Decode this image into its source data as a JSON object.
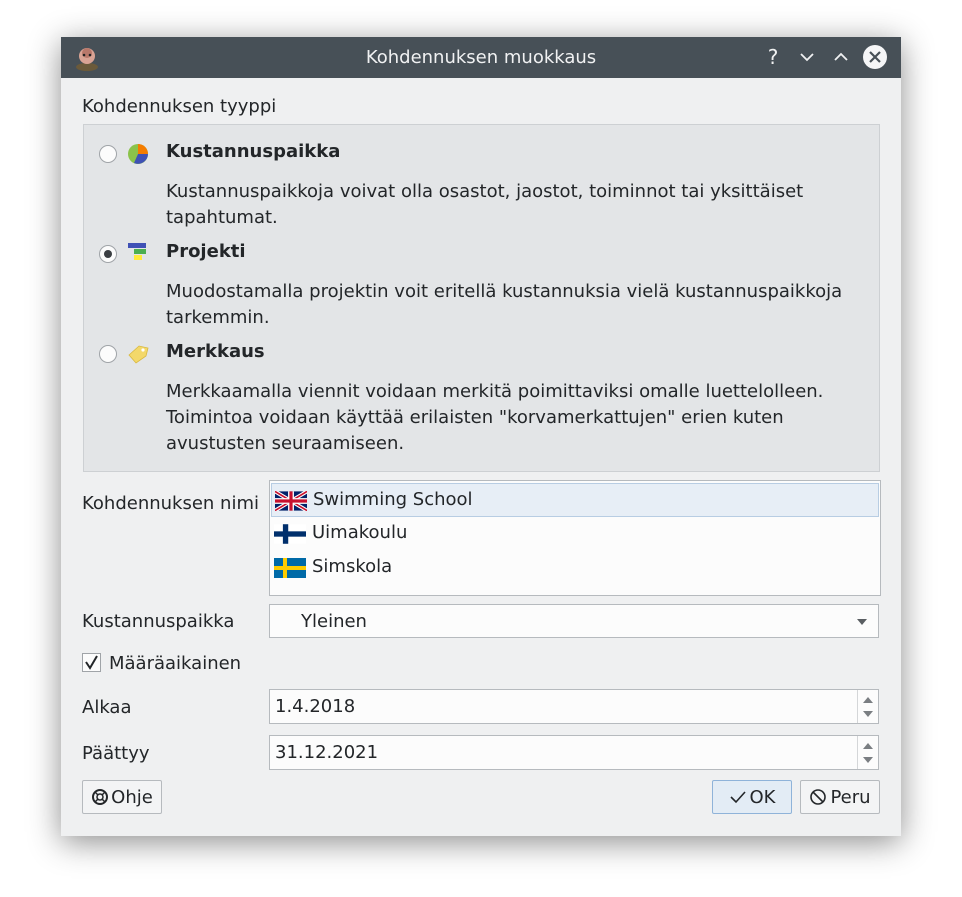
{
  "window": {
    "title": "Kohdennuksen muokkaus"
  },
  "titlebar": {
    "help": "?"
  },
  "allocation_type": {
    "label": "Kohdennuksen tyyppi",
    "options": [
      {
        "title": "Kustannuspaikka",
        "desc_line1": "Kustannuspaikkoja voivat olla osastot, jaostot, toiminnot tai yksittäiset",
        "desc_line2": "tapahtumat.",
        "checked": false
      },
      {
        "title": "Projekti",
        "desc_line1": "Muodostamalla projektin voit eritellä kustannuksia vielä kustannuspaikkoja",
        "desc_line2": "tarkemmin.",
        "checked": true
      },
      {
        "title": "Merkkaus",
        "desc_line1": "Merkkaamalla viennit voidaan merkitä poimittaviksi omalle luettelolleen.",
        "desc_line2": "Toimintoa voidaan käyttää erilaisten \"korvamerkattujen\" erien kuten",
        "desc_line3": "avustusten seuraamiseen.",
        "checked": false
      }
    ]
  },
  "name_field": {
    "label": "Kohdennuksen nimi",
    "entries": [
      {
        "lang": "en",
        "value": "Swimming School",
        "selected": true
      },
      {
        "lang": "fi",
        "value": "Uimakoulu",
        "selected": false
      },
      {
        "lang": "sv",
        "value": "Simskola",
        "selected": false
      }
    ]
  },
  "cost_center": {
    "label": "Kustannuspaikka",
    "value": "Yleinen"
  },
  "fixed_term": {
    "label": "Määräaikainen",
    "checked": true
  },
  "start": {
    "label": "Alkaa",
    "value": "1.4.2018"
  },
  "end": {
    "label": "Päättyy",
    "value": "31.12.2021"
  },
  "buttons": {
    "help": "Ohje",
    "ok": "OK",
    "cancel": "Peru"
  },
  "colors": {
    "titlebar": "#475057",
    "window": "#eff0f1",
    "group": "#e3e5e7",
    "accent": "#3daee9"
  }
}
